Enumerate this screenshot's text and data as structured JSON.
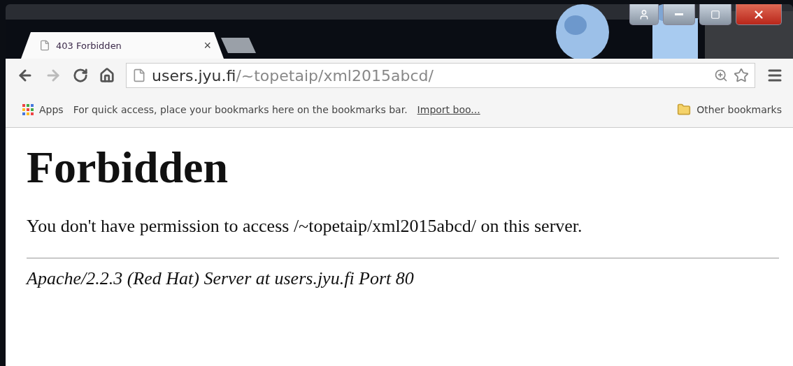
{
  "tabs": [
    {
      "title": "403 Forbidden",
      "close": "×",
      "selected": true
    }
  ],
  "address_bar": {
    "host": "users.jyu.fi",
    "path": "/~topetaip/xml2015abcd/"
  },
  "bookmarks_bar": {
    "apps": "Apps",
    "hint": "For quick access, place your bookmarks here on the bookmarks bar.",
    "import_link": "Import boo...",
    "other": "Other bookmarks"
  },
  "page": {
    "heading": "Forbidden",
    "message": "You don't have permission to access /~topetaip/xml2015abcd/ on this server.",
    "address": "Apache/2.2.3 (Red Hat) Server at users.jyu.fi Port 80"
  }
}
